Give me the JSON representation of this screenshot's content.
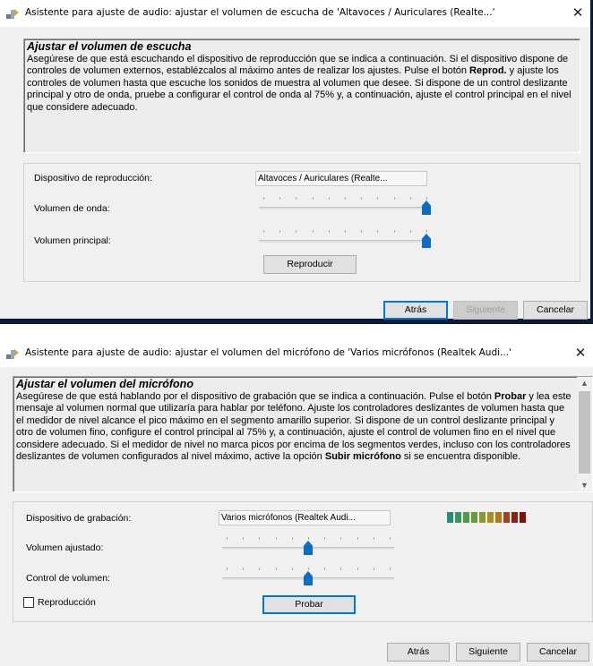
{
  "dialog1": {
    "title": "Asistente para ajuste de audio: ajustar el volumen de escucha de 'Altavoces / Auriculares (Realte...'",
    "close_glyph": "✕",
    "heading": "Ajustar el volumen de escucha",
    "body": "Asegúrese de que está escuchando el dispositivo de reproducción que se indica a continuación. Si el dispositivo dispone de controles de volumen externos, establézcalos al máximo antes de realizar los ajustes. Pulse el botón",
    "body_bold": "Reprod.",
    "body_end": "y ajuste los controles de volumen hasta que escuche los sonidos de muestra al volumen que desee. Si dispone de un control deslizante principal y otro de onda, pruebe a configurar el control de onda al 75% y, a continuación, ajuste el control principal en el nivel que considere adecuado.",
    "device_label": "Dispositivo de reproducción:",
    "device_value": "Altavoces / Auriculares (Realte...",
    "wave_label": "Volumen de onda:",
    "wave_level": 1.0,
    "master_label": "Volumen principal:",
    "master_level": 1.0,
    "play_button": "Reproducir",
    "back_button": "Atrás",
    "next_button": "Siguiente",
    "cancel_button": "Cancelar"
  },
  "dialog2": {
    "title": "Asistente para ajuste de audio: ajustar el volumen del micrófono de 'Varios micrófonos (Realtek Audi...'",
    "close_glyph": "✕",
    "heading": "Ajustar el volumen del micrófono",
    "body_1": "Asegúrese de que está hablando por el dispositivo de grabación que se indica a continuación. Pulse el botón",
    "body_bold_1": "Probar",
    "body_2": "y lea este mensaje al volumen normal que utilizaría para hablar por teléfono. Ajuste los controladores deslizantes de volumen hasta que el medidor de nivel alcance el pico máximo en el segmento amarillo superior. Si dispone de un control deslizante principal y otro de volumen fino, configure el control principal al 75% y, a continuación, ajuste el control de volumen fino en el nivel que considere adecuado. Si el medidor de nivel no marca picos por encima de los segmentos verdes, incluso con los controladores deslizantes de volumen configurados al nivel máximo, active la opción",
    "body_bold_2": "Subir micrófono",
    "body_3": "si se encuentra disponible.",
    "device_label": "Dispositivo de grabación:",
    "device_value": "Varios micrófonos (Realtek Audi...",
    "adjusted_label": "Volumen ajustado:",
    "adjusted_level": 0.5,
    "control_label": "Control de volumen:",
    "control_level": 0.5,
    "playback_checkbox": "Reproducción",
    "playback_checked": false,
    "test_button": "Probar",
    "back_button": "Atrás",
    "next_button": "Siguiente",
    "cancel_button": "Cancelar",
    "meter_colors": [
      "#2a8c78",
      "#3a9466",
      "#4f9a4a",
      "#6a9a3a",
      "#8a9830",
      "#a89020",
      "#b47818",
      "#a8401c",
      "#902016",
      "#801010"
    ]
  }
}
